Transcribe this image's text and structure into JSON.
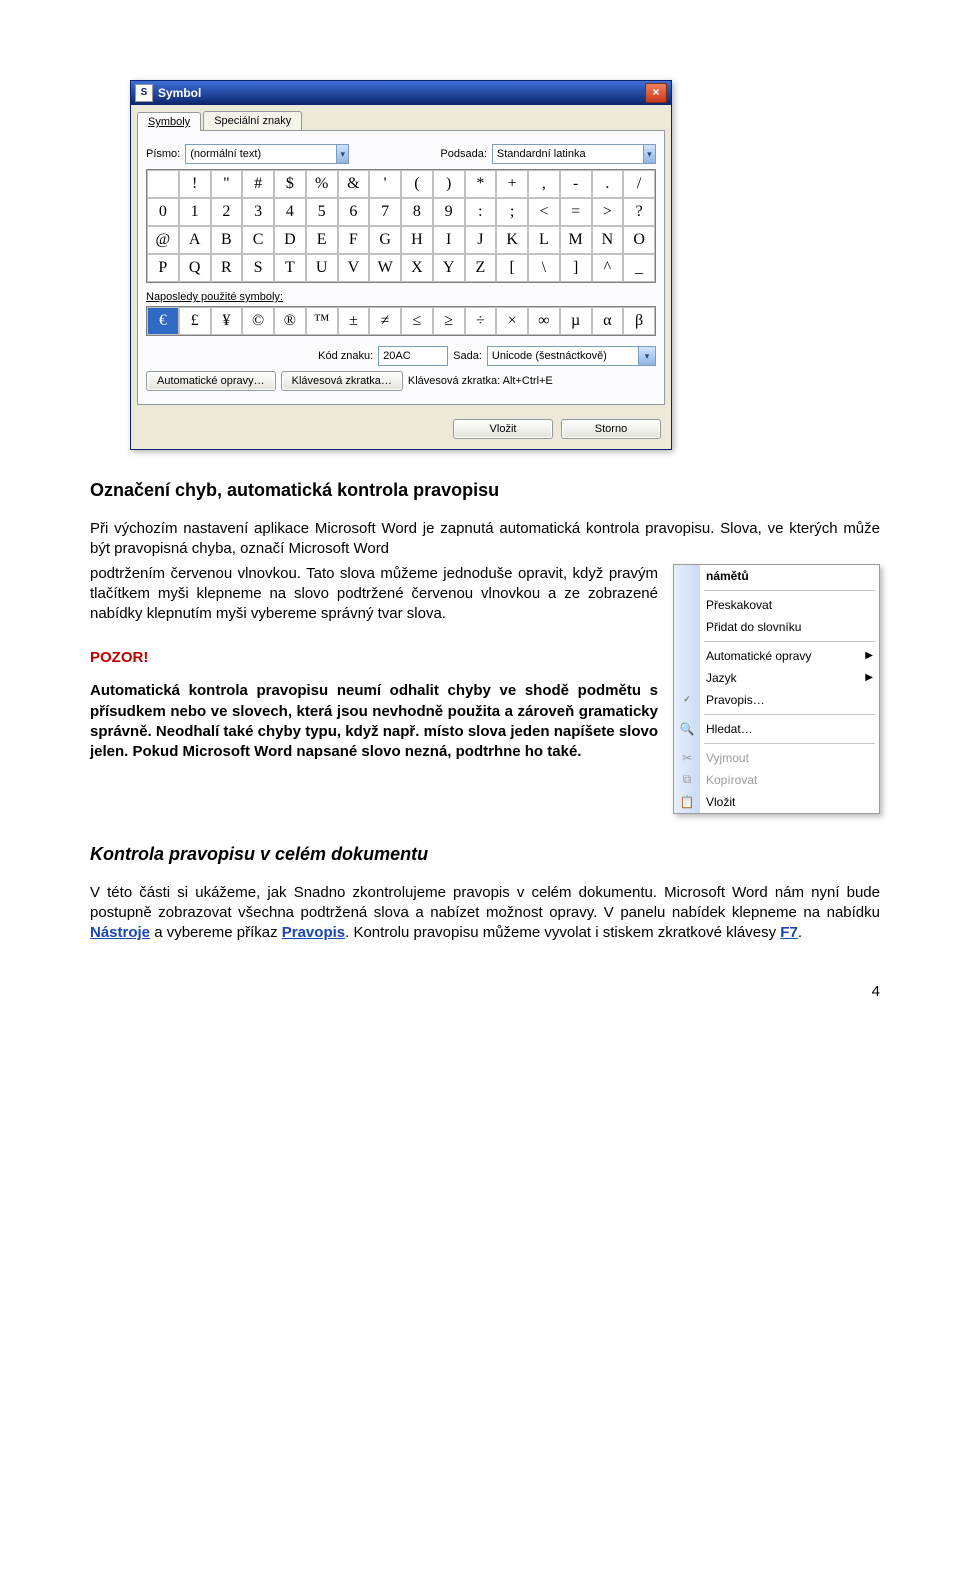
{
  "symbol_dialog": {
    "title": "Symbol",
    "tabs": {
      "symbols": "Symboly",
      "special": "Speciální znaky"
    },
    "font_label": "Písmo:",
    "font_value": "(normální text)",
    "subset_label": "Podsada:",
    "subset_value": "Standardní latinka",
    "grid_row1": [
      " ",
      "!",
      "\"",
      "#",
      "$",
      "%",
      "&",
      "'",
      "(",
      ")",
      "*",
      "+",
      ",",
      "-",
      ".",
      "/"
    ],
    "grid_row2": [
      "0",
      "1",
      "2",
      "3",
      "4",
      "5",
      "6",
      "7",
      "8",
      "9",
      ":",
      ";",
      "<",
      "=",
      ">",
      "?"
    ],
    "grid_row3": [
      "@",
      "A",
      "B",
      "C",
      "D",
      "E",
      "F",
      "G",
      "H",
      "I",
      "J",
      "K",
      "L",
      "M",
      "N",
      "O"
    ],
    "grid_row4": [
      "P",
      "Q",
      "R",
      "S",
      "T",
      "U",
      "V",
      "W",
      "X",
      "Y",
      "Z",
      "[",
      "\\",
      "]",
      "^",
      "_"
    ],
    "recent_label": "Naposledy použité symboly:",
    "recent": [
      "€",
      "£",
      "¥",
      "©",
      "®",
      "™",
      "±",
      "≠",
      "≤",
      "≥",
      "÷",
      "×",
      "∞",
      "µ",
      "α",
      "β"
    ],
    "code_label": "Kód znaku:",
    "code_value": "20AC",
    "from_label": "Sada:",
    "from_value": "Unicode (šestnáctkově)",
    "autocorrect_btn": "Automatické opravy…",
    "shortcut_btn": "Klávesová zkratka…",
    "shortcut_label": "Klávesová zkratka: Alt+Ctrl+E",
    "insert_btn": "Vložit",
    "cancel_btn": "Storno"
  },
  "context_menu": {
    "suggestion": "námětů",
    "ignore": "Přeskakovat",
    "add": "Přidat do slovníku",
    "autocorrect": "Automatické opravy",
    "language": "Jazyk",
    "spelling": "Pravopis…",
    "lookup": "Hledat…",
    "cut": "Vyjmout",
    "copy": "Kopírovat",
    "paste": "Vložit"
  },
  "doc": {
    "h1": "Označení chyb, automatická kontrola pravopisu",
    "p1a": "Při výchozím nastavení aplikace Microsoft Word je zapnutá automatická kontrola pravopisu. Slova, ve kterých může být pravopisná chyba, označí Microsoft Word",
    "p1b": "podtržením červenou vlnovkou. Tato slova můžeme jednoduše opravit, když pravým tlačítkem myši klepneme na slovo podtržené červenou vlnovkou a ze zobrazené nabídky klepnutím myši vybereme správný tvar slova.",
    "pozor": "POZOR!",
    "bold_block": "Automatická kontrola pravopisu neumí odhalit chyby ve shodě podmětu s přísudkem nebo ve slovech, která jsou nevhodně použita a zároveň gramaticky správně. Neodhalí také chyby typu, když např. místo slova jeden napíšete slovo jelen. Pokud Microsoft Word napsané slovo nezná, podtrhne ho také.",
    "h2": "Kontrola pravopisu v celém dokumentu",
    "p2_pre": "V této části si ukážeme, jak Snadno zkontrolujeme pravopis v celém dokumentu. Microsoft Word nám nyní bude postupně zobrazovat všechna podtržená slova a nabízet možnost opravy. V panelu nabídek klepneme na nabídku ",
    "link1": "Nástroje",
    "p2_mid": " a vybereme příkaz ",
    "link2": "Pravopis",
    "p2_mid2": ". Kontrolu pravopisu můžeme vyvolat i stiskem zkratkové klávesy ",
    "link3": "F7",
    "p2_end": ".",
    "page_num": "4"
  }
}
